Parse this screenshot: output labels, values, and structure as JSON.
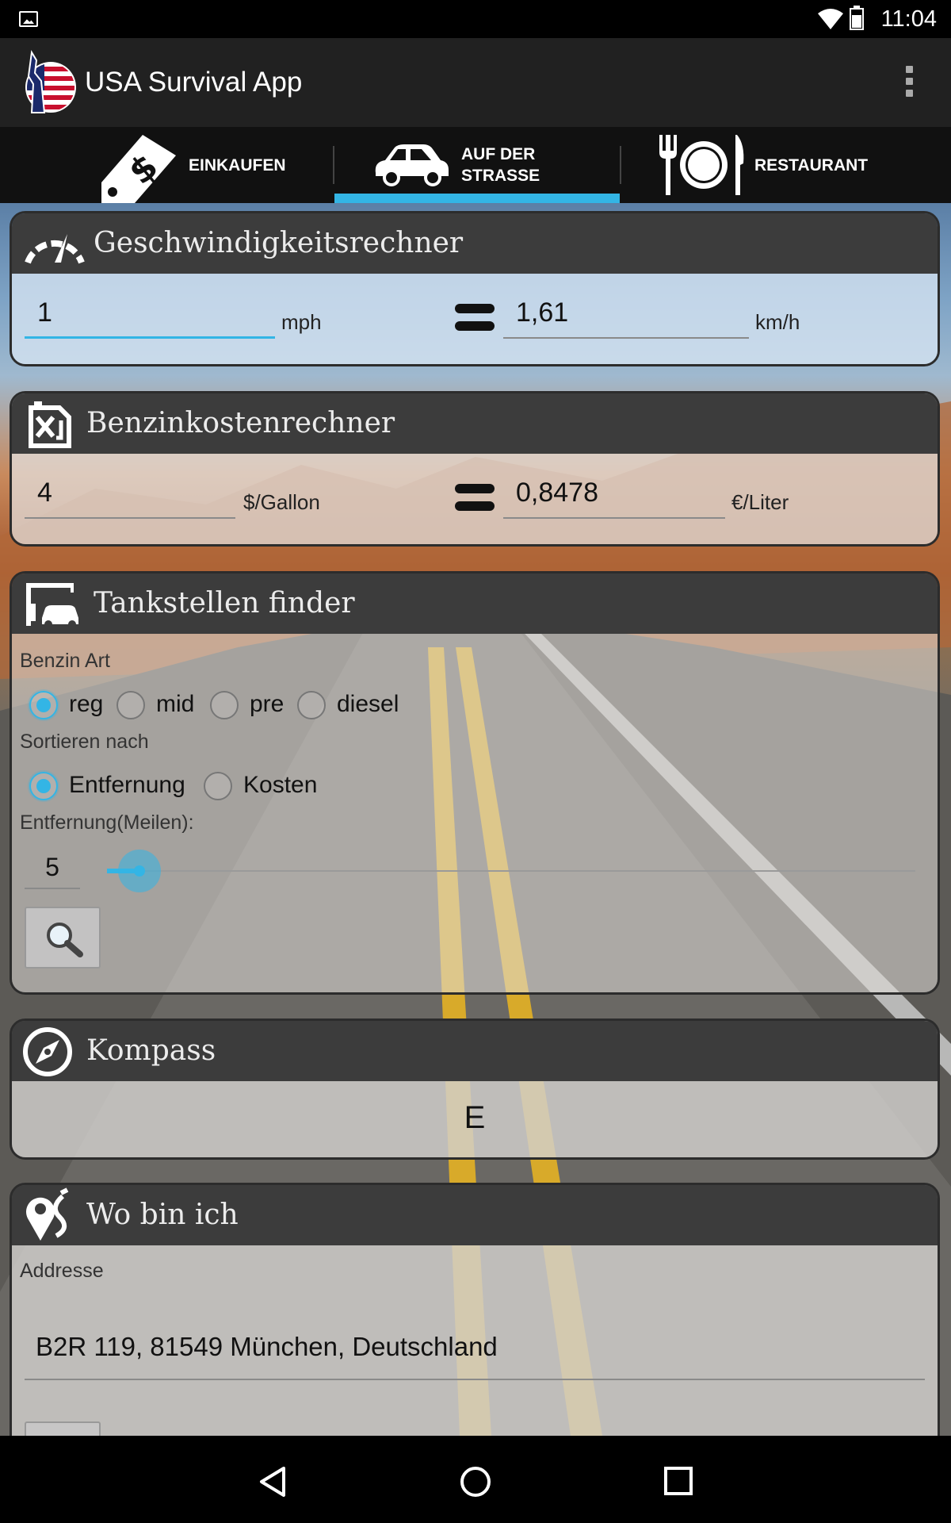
{
  "status_bar": {
    "time": "11:04"
  },
  "app": {
    "title": "USA Survival App"
  },
  "tabs": [
    {
      "label_line1": "EINKAUFEN",
      "label_line2": ""
    },
    {
      "label_line1": "AUF DER",
      "label_line2": "STRASSE"
    },
    {
      "label_line1": "RESTAURANT",
      "label_line2": ""
    }
  ],
  "speed_calc": {
    "title": "Geschwindigkeitsrechner",
    "input_value": "1",
    "input_unit": "mph",
    "result_value": "1,61",
    "result_unit": "km/h"
  },
  "fuel_calc": {
    "title": "Benzinkostenrechner",
    "input_value": "4",
    "input_unit": "$/Gallon",
    "result_value": "0,8478",
    "result_unit": "€/Liter"
  },
  "station_finder": {
    "title": "Tankstellen finder",
    "fuel_type_label": "Benzin Art",
    "fuel_types": [
      "reg",
      "mid",
      "pre",
      "diesel"
    ],
    "fuel_type_selected": "reg",
    "sort_label": "Sortieren nach",
    "sort_options": [
      "Entfernung",
      "Kosten"
    ],
    "sort_selected": "Entfernung",
    "distance_label": "Entfernung(Meilen):",
    "distance_value": "5"
  },
  "compass": {
    "title": "Kompass",
    "direction": "E"
  },
  "location": {
    "title": "Wo bin ich",
    "address_label": "Addresse",
    "address_value": "B2R 119, 81549 München, Deutschland"
  },
  "colors": {
    "accent": "#33b5e5",
    "header": "#3c3c3c",
    "actionbar": "#212121"
  }
}
